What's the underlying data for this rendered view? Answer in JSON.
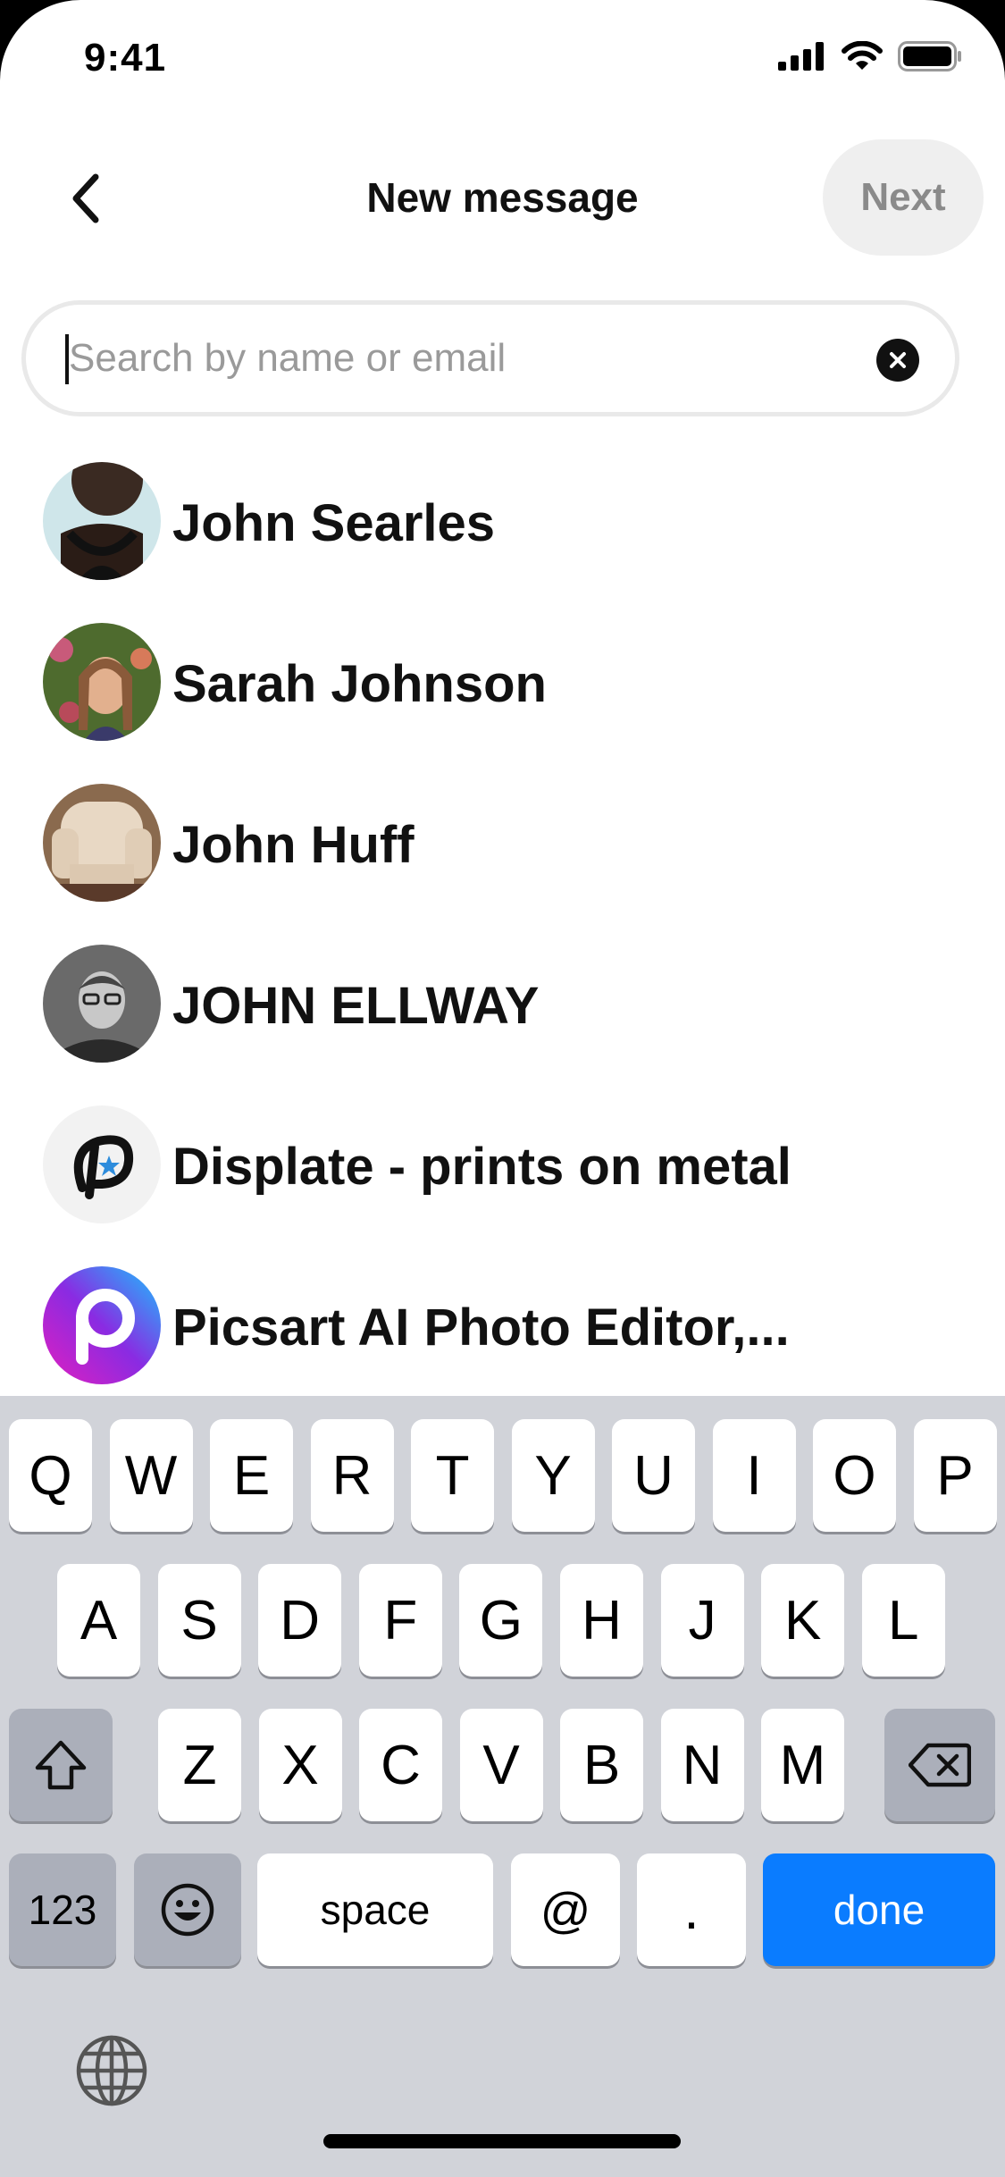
{
  "status_bar": {
    "time": "9:41",
    "icons": [
      "cellular-icon",
      "wifi-icon",
      "battery-icon"
    ]
  },
  "header": {
    "back_icon": "chevron-left-icon",
    "title": "New message",
    "next_label": "Next"
  },
  "search": {
    "placeholder": "Search by name or email",
    "value": "",
    "clear_icon": "clear-icon"
  },
  "contacts": [
    {
      "name": "John Searles"
    },
    {
      "name": "Sarah Johnson"
    },
    {
      "name": "John Huff"
    },
    {
      "name": "JOHN ELLWAY"
    },
    {
      "name": "Displate - prints on metal"
    },
    {
      "name": "Picsart AI Photo Editor,..."
    }
  ],
  "keyboard": {
    "row1": [
      "Q",
      "W",
      "E",
      "R",
      "T",
      "Y",
      "U",
      "I",
      "O",
      "P"
    ],
    "row2": [
      "A",
      "S",
      "D",
      "F",
      "G",
      "H",
      "J",
      "K",
      "L"
    ],
    "row3": [
      "Z",
      "X",
      "C",
      "V",
      "B",
      "N",
      "M"
    ],
    "numbers_label": "123",
    "space_label": "space",
    "at_label": "@",
    "period_label": ".",
    "done_label": "done"
  },
  "colors": {
    "accent": "#0a7cff",
    "keyboard_bg": "#d1d3d9"
  }
}
